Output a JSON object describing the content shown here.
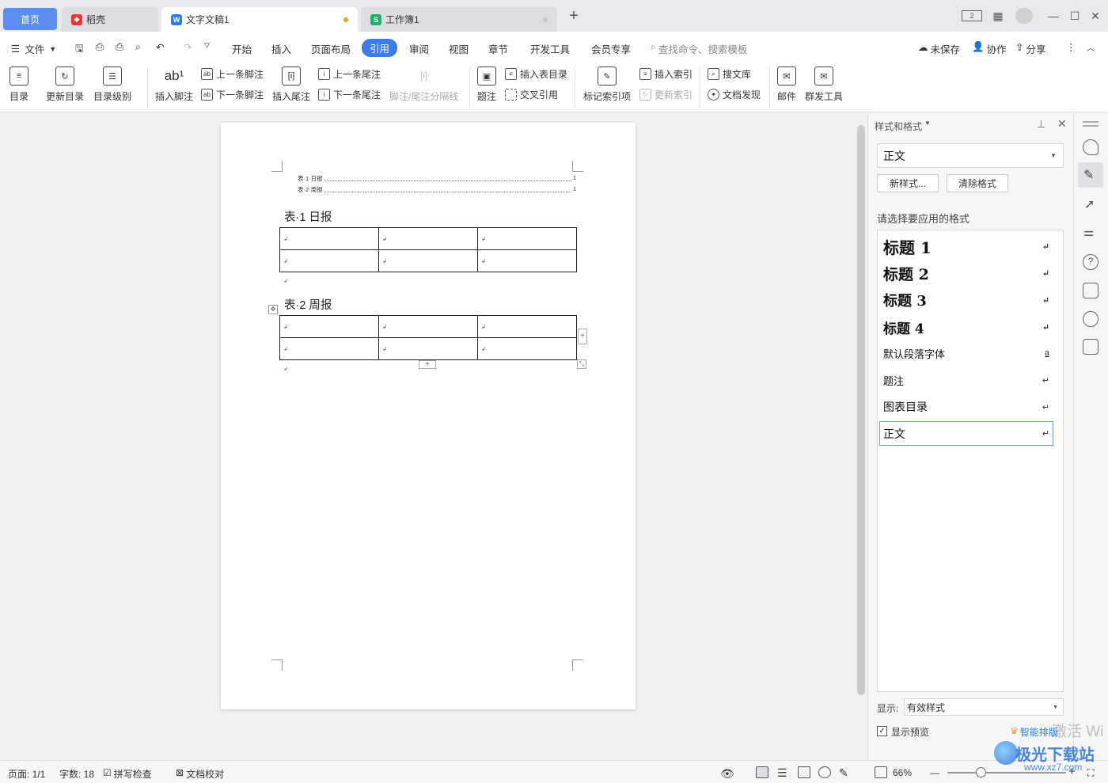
{
  "tabs": [
    {
      "label": "首页"
    },
    {
      "label": "稻壳"
    },
    {
      "label": "文字文稿1"
    },
    {
      "label": "工作簿1"
    }
  ],
  "titlebar": {
    "layout_badge": "2"
  },
  "menu": {
    "file": "文件",
    "items": [
      "开始",
      "插入",
      "页面布局",
      "引用",
      "审阅",
      "视图",
      "章节",
      "开发工具",
      "会员专享"
    ],
    "search_placeholder": "查找命令、搜索模板",
    "unsaved": "未保存",
    "collab": "协作",
    "share": "分享"
  },
  "ribbon": {
    "toc": "目录",
    "update_toc": "更新目录",
    "toc_level": "目录级别",
    "insert_footnote": "插入脚注",
    "prev_footnote": "上一条脚注",
    "next_footnote": "下一条脚注",
    "insert_endnote": "插入尾注",
    "prev_endnote": "上一条尾注",
    "next_endnote": "下一条尾注",
    "separator": "脚注/尾注分隔线",
    "caption": "题注",
    "insert_table_toc": "插入表目录",
    "cross_ref": "交叉引用",
    "mark_index": "标记索引项",
    "insert_index": "插入索引",
    "update_index": "更新索引",
    "search_lib": "搜文库",
    "doc_discover": "文档发现",
    "mail": "邮件",
    "mass_tools": "群发工具"
  },
  "document": {
    "toc_entries": [
      {
        "label": "表·1·日报",
        "page": "1"
      },
      {
        "label": "表·2·周报",
        "page": "1"
      }
    ],
    "tables": [
      {
        "caption": "表·1 日报",
        "rows": 2,
        "cols": 3
      },
      {
        "caption": "表·2 周报",
        "rows": 2,
        "cols": 3
      }
    ],
    "para_mark": "↲"
  },
  "panel": {
    "title": "样式和格式",
    "current_style": "正文",
    "new_style": "新样式...",
    "clear_format": "清除格式",
    "prompt": "请选择要应用的格式",
    "styles": [
      "标题 1",
      "标题 2",
      "标题 3",
      "标题 4",
      "默认段落字体",
      "题注",
      "图表目录",
      "正文"
    ],
    "show_label": "显示:",
    "show_value": "有效样式",
    "show_preview": "显示预览",
    "smart_layout": "智能排版"
  },
  "status": {
    "page": "页面: 1/1",
    "words": "字数: 18",
    "spell": "拼写检查",
    "proofread": "文档校对",
    "zoom": "66%"
  },
  "watermark": {
    "activate": "激活 Wi",
    "site": "极光下载站",
    "url": "www.xz7.com"
  },
  "colors": {
    "accent": "#3b7cf2",
    "home_tab": "#5b8ef0",
    "daoke": "#e5383b",
    "word": "#2b7cf2",
    "sheet": "#1fb06a"
  }
}
